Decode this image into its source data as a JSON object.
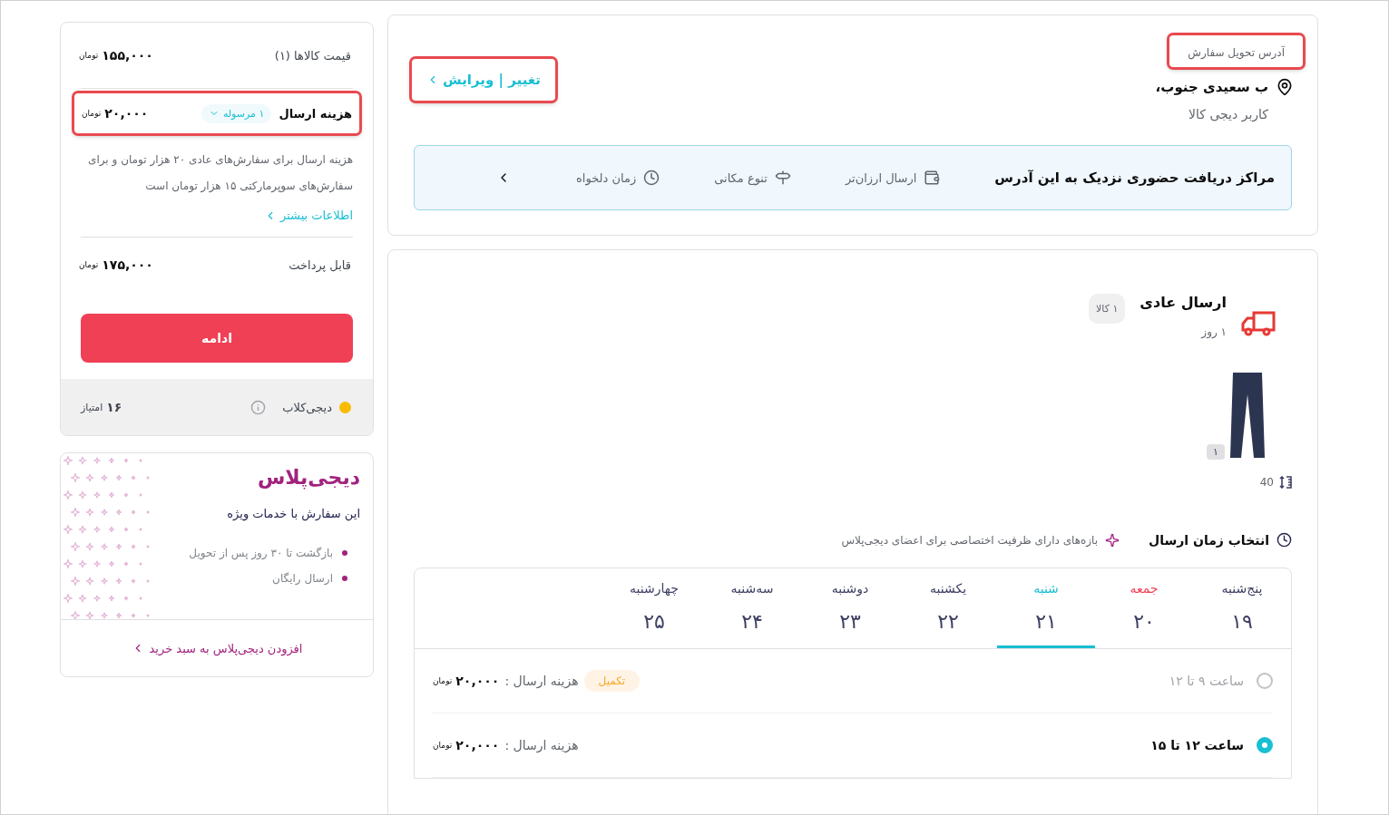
{
  "address": {
    "label": "آدرس تحویل سفارش",
    "label_highlighted": true,
    "street": "ب سعیدی جنوب،",
    "recipient": "کاربر دیجی کالا",
    "edit_link": "تغییر | ویرایش",
    "edit_highlighted": true
  },
  "pickup_banner": {
    "title": "مراکز دریافت حضوری نزدیک به این آدرس",
    "features": [
      {
        "kind": "wallet",
        "label": "ارسال ارزان‌تر"
      },
      {
        "kind": "signpost",
        "label": "تنوع مکانی"
      },
      {
        "kind": "clock",
        "label": "زمان دلخواه"
      }
    ]
  },
  "shipment": {
    "title": "ارسال عادی",
    "count_badge": "۱ کالا",
    "duration": "۱ روز",
    "product": {
      "quantity": "۱",
      "size": "40"
    },
    "time_heading": "انتخاب زمان ارسال",
    "plus_note": "بازه‌های دارای ظرفیت اختصاصی برای اعضای دیجی‌پلاس",
    "days": [
      {
        "name": "پنج‌شنبه",
        "date": "۱۹",
        "holiday": false,
        "selected": false
      },
      {
        "name": "جمعه",
        "date": "۲۰",
        "holiday": true,
        "selected": false
      },
      {
        "name": "شنبه",
        "date": "۲۱",
        "holiday": false,
        "selected": true
      },
      {
        "name": "یکشنبه",
        "date": "۲۲",
        "holiday": false,
        "selected": false
      },
      {
        "name": "دوشنبه",
        "date": "۲۳",
        "holiday": false,
        "selected": false
      },
      {
        "name": "سه‌شنبه",
        "date": "۲۴",
        "holiday": false,
        "selected": false
      },
      {
        "name": "چهارشنبه",
        "date": "۲۵",
        "holiday": false,
        "selected": false
      }
    ],
    "slots": [
      {
        "time": "ساعت  ۹ تا ۱۲",
        "disabled": true,
        "selected": false,
        "badge": "تکمیل",
        "cost_label": "هزینه ارسال :",
        "cost": "۲۰,۰۰۰",
        "currency": "تومان"
      },
      {
        "time": "ساعت  ۱۲ تا ۱۵",
        "disabled": false,
        "selected": true,
        "cost_label": "هزینه ارسال :",
        "cost": "۲۰,۰۰۰",
        "currency": "تومان"
      }
    ]
  },
  "summary": {
    "items_label": "قیمت کالاها (۱)",
    "items_price": "۱۵۵,۰۰۰",
    "items_currency": "تومان",
    "shipping_label": "هزینه ارسال",
    "shipping_chip": "۱ مرسوله",
    "shipping_price": "۲۰,۰۰۰",
    "shipping_currency": "تومان",
    "shipping_highlighted": true,
    "shipping_note": "هزینه ارسال برای سفارش‌های عادی ۲۰ هزار تومان و برای سفارش‌های سوپرمارکتی ۱۵ هزار تومان است",
    "more_link": "اطلاعات بیشتر",
    "payable_label": "قابل پرداخت",
    "payable_price": "۱۷۵,۰۰۰",
    "payable_currency": "تومان",
    "continue_button": "ادامه",
    "club_label": "دیجی‌کلاب",
    "points": "۱۶",
    "points_label": "امتیاز"
  },
  "digiplus": {
    "logo": "دیجی‌پلاس",
    "subtitle": "این سفارش با خدمات ویژه",
    "benefits": [
      "بازگشت تا ۳۰ روز پس از تحویل",
      "ارسال رایگان"
    ],
    "add_link": "افزودن دیجی‌پلاس به سبد خرید"
  }
}
